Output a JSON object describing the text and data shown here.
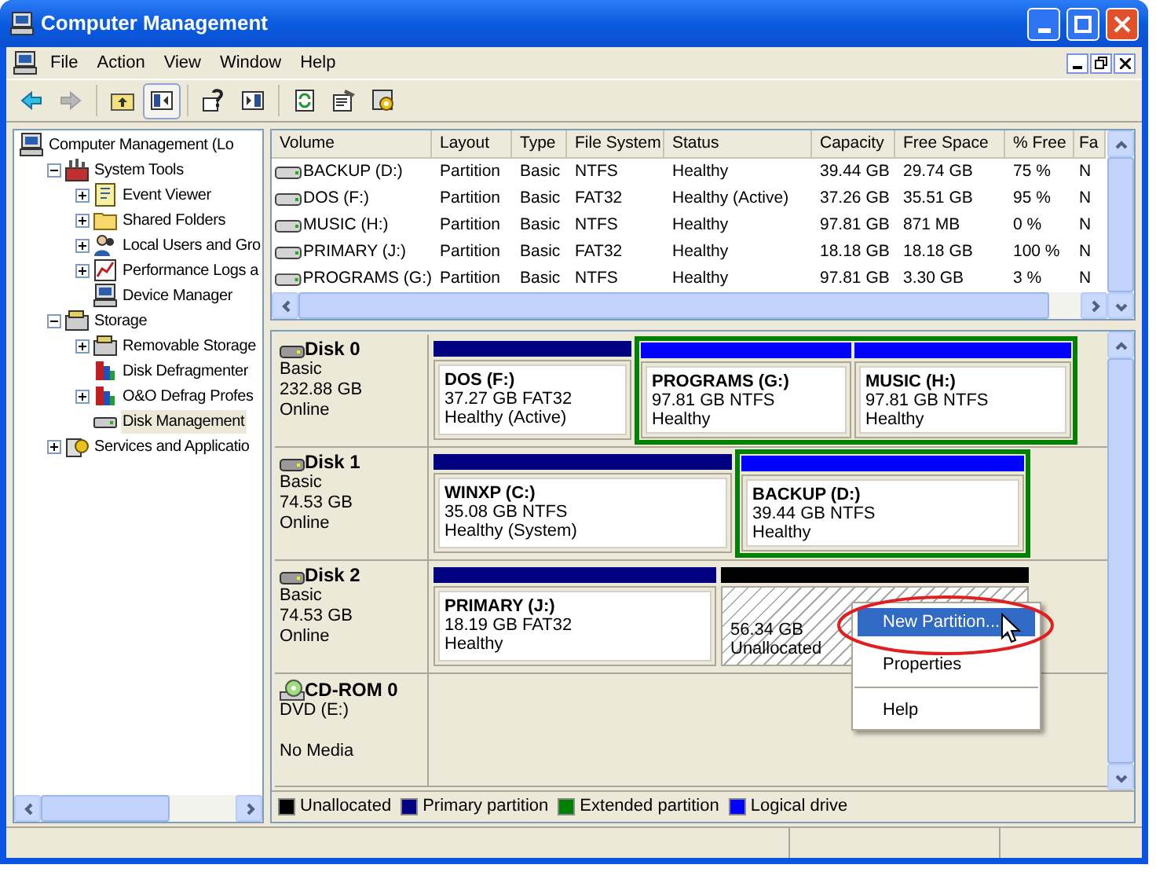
{
  "window": {
    "title": "Computer Management"
  },
  "menu": [
    "File",
    "Action",
    "View",
    "Window",
    "Help"
  ],
  "toolbar": [
    {
      "kind": "back",
      "disabled": false
    },
    {
      "kind": "forward",
      "disabled": true
    },
    {
      "kind": "up"
    },
    {
      "kind": "tree",
      "on": true
    },
    {
      "kind": "help"
    },
    {
      "kind": "pane"
    },
    {
      "kind": "refresh"
    },
    {
      "kind": "properties"
    },
    {
      "kind": "settings"
    }
  ],
  "tree": [
    {
      "label": "Computer Management (Lo",
      "kind": "computer",
      "selected": false,
      "children": [
        {
          "label": "System Tools",
          "kind": "tools",
          "expanded": true,
          "selected": false,
          "children": [
            {
              "label": "Event Viewer",
              "kind": "viewer",
              "expanded": false,
              "selected": false
            },
            {
              "label": "Shared Folders",
              "kind": "folder",
              "expanded": false,
              "selected": false
            },
            {
              "label": "Local Users and Gro",
              "kind": "users",
              "expanded": false,
              "selected": false
            },
            {
              "label": "Performance Logs a",
              "kind": "perf",
              "expanded": false,
              "selected": false
            },
            {
              "label": "Device Manager",
              "kind": "computer",
              "selected": false
            }
          ]
        },
        {
          "label": "Storage",
          "kind": "storage",
          "expanded": true,
          "selected": false,
          "children": [
            {
              "label": "Removable Storage",
              "kind": "storage",
              "expanded": false,
              "selected": false
            },
            {
              "label": "Disk Defragmenter",
              "kind": "defrag",
              "selected": false
            },
            {
              "label": "O&O Defrag Profes",
              "kind": "defrag",
              "expanded": false,
              "selected": false
            },
            {
              "label": "Disk Management",
              "kind": "drive",
              "selected": true
            }
          ]
        },
        {
          "label": "Services and Applicatio",
          "kind": "services",
          "expanded": false,
          "selected": false
        }
      ]
    }
  ],
  "volumes": {
    "columns": [
      "Volume",
      "Layout",
      "Type",
      "File System",
      "Status",
      "Capacity",
      "Free Space",
      "% Free",
      "Fa"
    ],
    "rows": [
      [
        "BACKUP (D:)",
        "Partition",
        "Basic",
        "NTFS",
        "Healthy",
        "39.44 GB",
        "29.74 GB",
        "75 %",
        "N"
      ],
      [
        "DOS (F:)",
        "Partition",
        "Basic",
        "FAT32",
        "Healthy (Active)",
        "37.26 GB",
        "35.51 GB",
        "95 %",
        "N"
      ],
      [
        "MUSIC (H:)",
        "Partition",
        "Basic",
        "NTFS",
        "Healthy",
        "97.81 GB",
        "871 MB",
        "0 %",
        "N"
      ],
      [
        "PRIMARY (J:)",
        "Partition",
        "Basic",
        "FAT32",
        "Healthy",
        "18.18 GB",
        "18.18 GB",
        "100 %",
        "N"
      ],
      [
        "PROGRAMS (G:)",
        "Partition",
        "Basic",
        "NTFS",
        "Healthy",
        "97.81 GB",
        "3.30 GB",
        "3 %",
        "N"
      ]
    ]
  },
  "disks": [
    {
      "kind": "disk",
      "name": "Disk 0",
      "lines": [
        "Basic",
        "232.88 GB",
        "Online"
      ],
      "partitions": [
        {
          "kind": "primary",
          "title": "DOS (F:)",
          "size": "37.27 GB FAT32",
          "status": "Healthy (Active)"
        },
        {
          "kind": "extended",
          "children": [
            {
              "kind": "logical",
              "title": "PROGRAMS (G:)",
              "size": "97.81 GB NTFS",
              "status": "Healthy"
            },
            {
              "kind": "logical",
              "title": "MUSIC (H:)",
              "size": "97.81 GB NTFS",
              "status": "Healthy"
            }
          ]
        }
      ]
    },
    {
      "kind": "disk",
      "name": "Disk 1",
      "lines": [
        "Basic",
        "74.53 GB",
        "Online"
      ],
      "partitions": [
        {
          "kind": "primary",
          "title": "WINXP (C:)",
          "size": "35.08 GB NTFS",
          "status": "Healthy (System)"
        },
        {
          "kind": "extended",
          "children": [
            {
              "kind": "logical",
              "title": "BACKUP (D:)",
              "size": "39.44 GB NTFS",
              "status": "Healthy"
            }
          ]
        }
      ]
    },
    {
      "kind": "disk",
      "name": "Disk 2",
      "lines": [
        "Basic",
        "74.53 GB",
        "Online"
      ],
      "partitions": [
        {
          "kind": "primary",
          "title": "PRIMARY (J:)",
          "size": "18.19 GB FAT32",
          "status": "Healthy"
        },
        {
          "kind": "unallocated",
          "size": "56.34 GB",
          "status": "Unallocated"
        }
      ]
    },
    {
      "kind": "cdrom",
      "name": "CD-ROM 0",
      "lines": [
        "DVD (E:)",
        "No Media"
      ]
    }
  ],
  "legend": [
    {
      "label": "Unallocated",
      "color": "#000000"
    },
    {
      "label": "Primary partition",
      "color": "#000080"
    },
    {
      "label": "Extended partition",
      "color": "#008000"
    },
    {
      "label": "Logical drive",
      "color": "#0000ff"
    }
  ],
  "context_menu": [
    {
      "kind": "item",
      "label": "New Partition...",
      "selected": true
    },
    {
      "kind": "item",
      "label": "Properties",
      "selected": false
    },
    {
      "kind": "separator"
    },
    {
      "kind": "item",
      "label": "Help",
      "selected": false
    }
  ]
}
